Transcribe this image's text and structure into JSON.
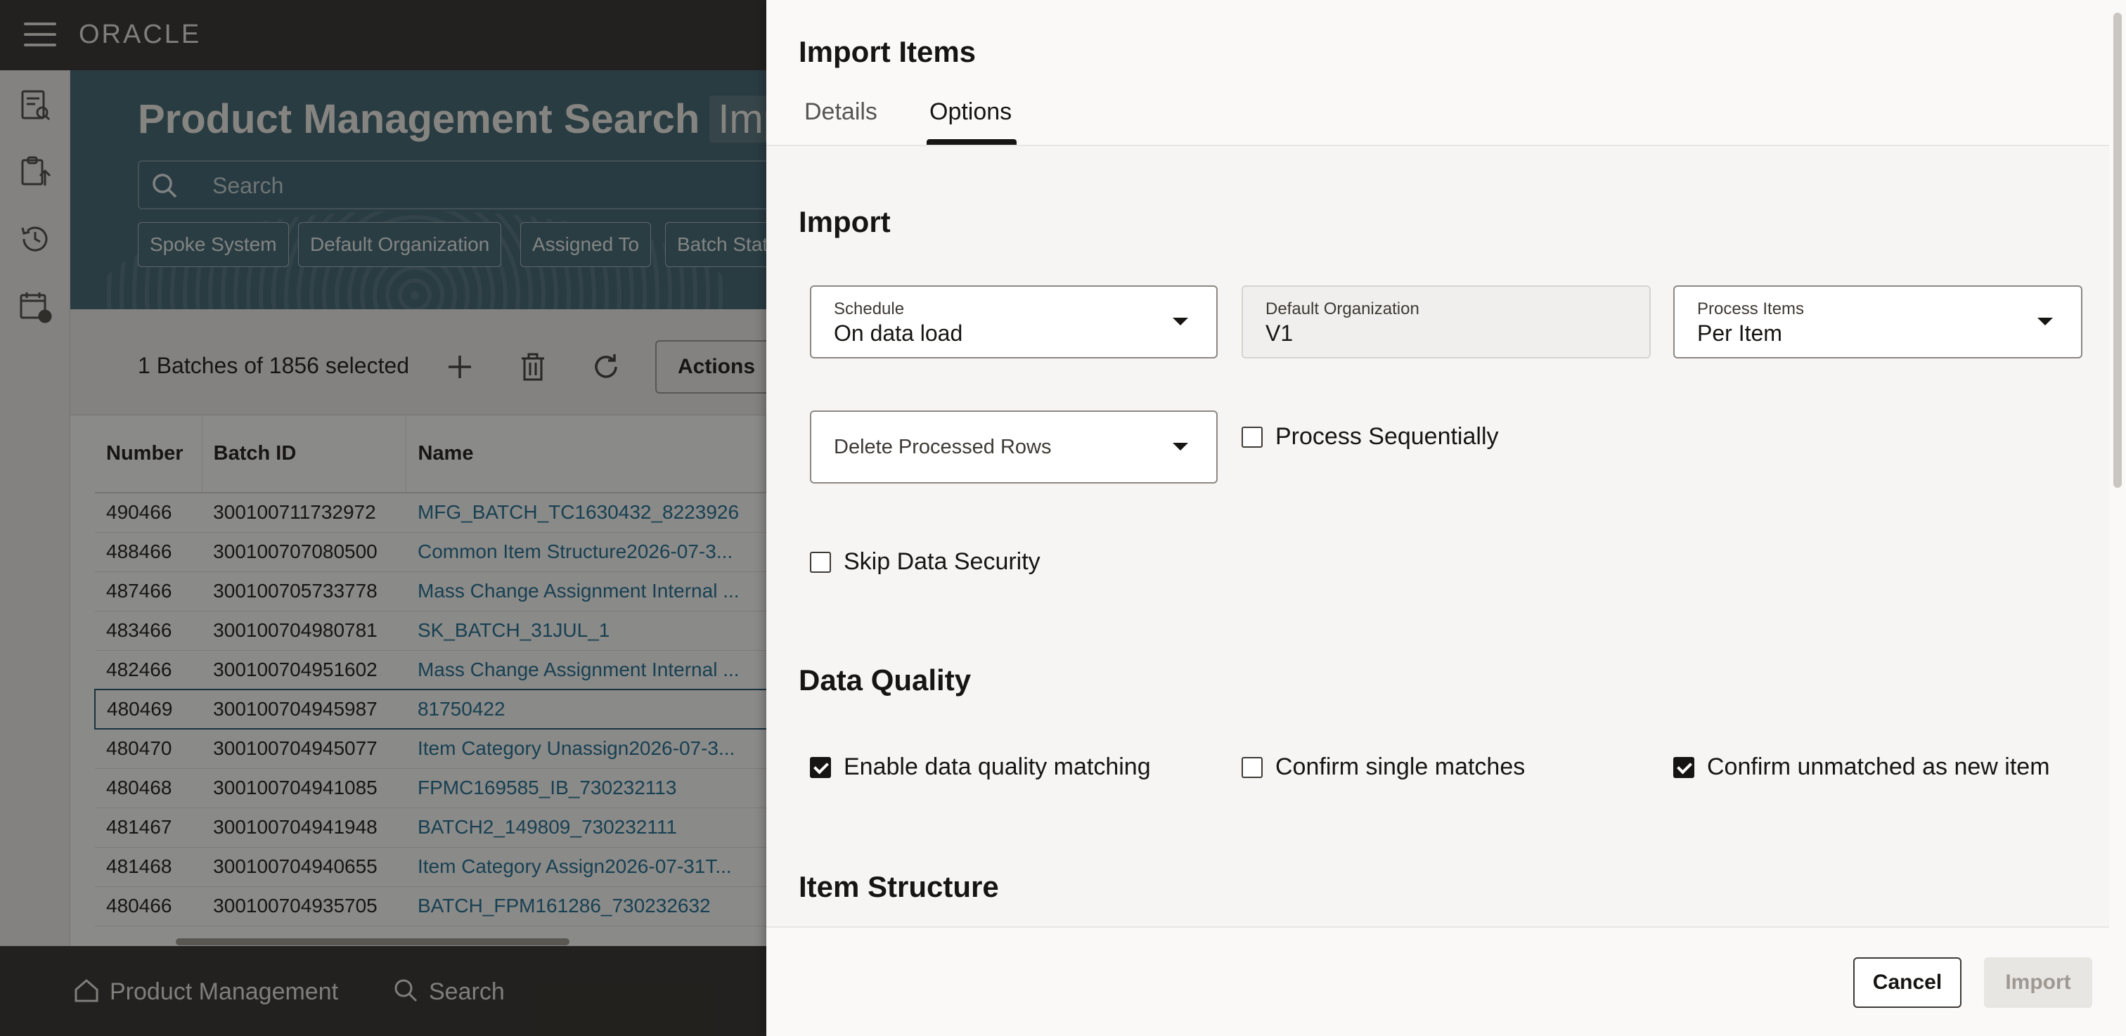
{
  "app": {
    "logo": "ORACLE"
  },
  "page": {
    "title": "Product Management Search",
    "title_extra": "Imp",
    "search_placeholder": "Search",
    "chips": [
      "Spoke System",
      "Default Organization",
      "Assigned To",
      "Batch Stat"
    ],
    "batch_count": "1 Batches of 1856 selected",
    "actions_label": "Actions"
  },
  "grid": {
    "headers": [
      "Number",
      "Batch ID",
      "Name"
    ],
    "rows": [
      [
        "490466",
        "300100711732972",
        "MFG_BATCH_TC1630432_8223926"
      ],
      [
        "488466",
        "300100707080500",
        "Common Item Structure2026-07-3..."
      ],
      [
        "487466",
        "300100705733778",
        "Mass Change Assignment Internal ..."
      ],
      [
        "483466",
        "300100704980781",
        "SK_BATCH_31JUL_1"
      ],
      [
        "482466",
        "300100704951602",
        "Mass Change Assignment Internal ..."
      ],
      [
        "480469",
        "300100704945987",
        "81750422"
      ],
      [
        "480470",
        "300100704945077",
        "Item Category Unassign2026-07-3..."
      ],
      [
        "480468",
        "300100704941085",
        "FPMC169585_IB_730232113"
      ],
      [
        "481467",
        "300100704941948",
        "BATCH2_149809_730232111"
      ],
      [
        "481468",
        "300100704940655",
        "Item Category Assign2026-07-31T..."
      ],
      [
        "480466",
        "300100704935705",
        "BATCH_FPM161286_730232632"
      ]
    ],
    "selected_row": 5
  },
  "bottom_nav": {
    "home": "Product Management",
    "search": "Search"
  },
  "drawer": {
    "title": "Import Items",
    "tabs": {
      "details": "Details",
      "options": "Options"
    },
    "import_section": {
      "title": "Import",
      "schedule": {
        "label": "Schedule",
        "value": "On data load"
      },
      "default_org": {
        "label": "Default Organization",
        "value": "V1"
      },
      "process_items": {
        "label": "Process Items",
        "value": "Per Item"
      },
      "delete_rows": {
        "label": "Delete Processed Rows"
      },
      "process_sequentially": {
        "label": "Process Sequentially",
        "checked": false
      },
      "skip_security": {
        "label": "Skip Data Security",
        "checked": false
      }
    },
    "quality_section": {
      "title": "Data Quality",
      "enable_matching": {
        "label": "Enable data quality matching",
        "checked": true
      },
      "confirm_single": {
        "label": "Confirm single matches",
        "checked": false
      },
      "confirm_unmatched": {
        "label": "Confirm unmatched as new item",
        "checked": true
      }
    },
    "structure_section": {
      "title": "Item Structure"
    },
    "footer": {
      "cancel": "Cancel",
      "import": "Import"
    }
  }
}
